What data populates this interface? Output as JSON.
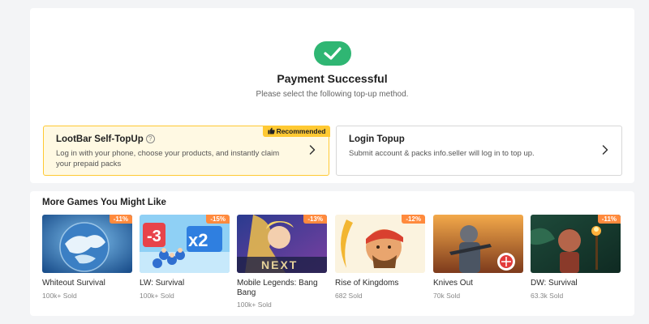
{
  "payment": {
    "title": "Payment Successful",
    "subtitle": "Please select the following top-up method.",
    "status_icon": "check-circle-icon",
    "accent_color": "#2fb673"
  },
  "options": [
    {
      "title": "LootBar Self-TopUp",
      "help_glyph": "?",
      "description": "Log in with your phone, choose your products, and instantly claim your prepaid packs",
      "badge": "Recommended",
      "badge_icon": "thumbs-up-icon",
      "highlight_color": "#ffc933"
    },
    {
      "title": "Login Topup",
      "description": "Submit account & packs info.seller will log in to top up."
    }
  ],
  "games_section": {
    "title": "More Games You Might Like",
    "games": [
      {
        "name": "Whiteout Survival",
        "sold": "100k+ Sold",
        "discount": "-11%"
      },
      {
        "name": "LW: Survival",
        "sold": "100k+ Sold",
        "discount": "-15%"
      },
      {
        "name": "Mobile Legends: Bang Bang",
        "sold": "100k+ Sold",
        "discount": "-13%"
      },
      {
        "name": "Rise of Kingdoms",
        "sold": "682 Sold",
        "discount": "-12%"
      },
      {
        "name": "Knives Out",
        "sold": "70k Sold",
        "discount": ""
      },
      {
        "name": "DW: Survival",
        "sold": "63.3k Sold",
        "discount": "-11%"
      }
    ]
  }
}
